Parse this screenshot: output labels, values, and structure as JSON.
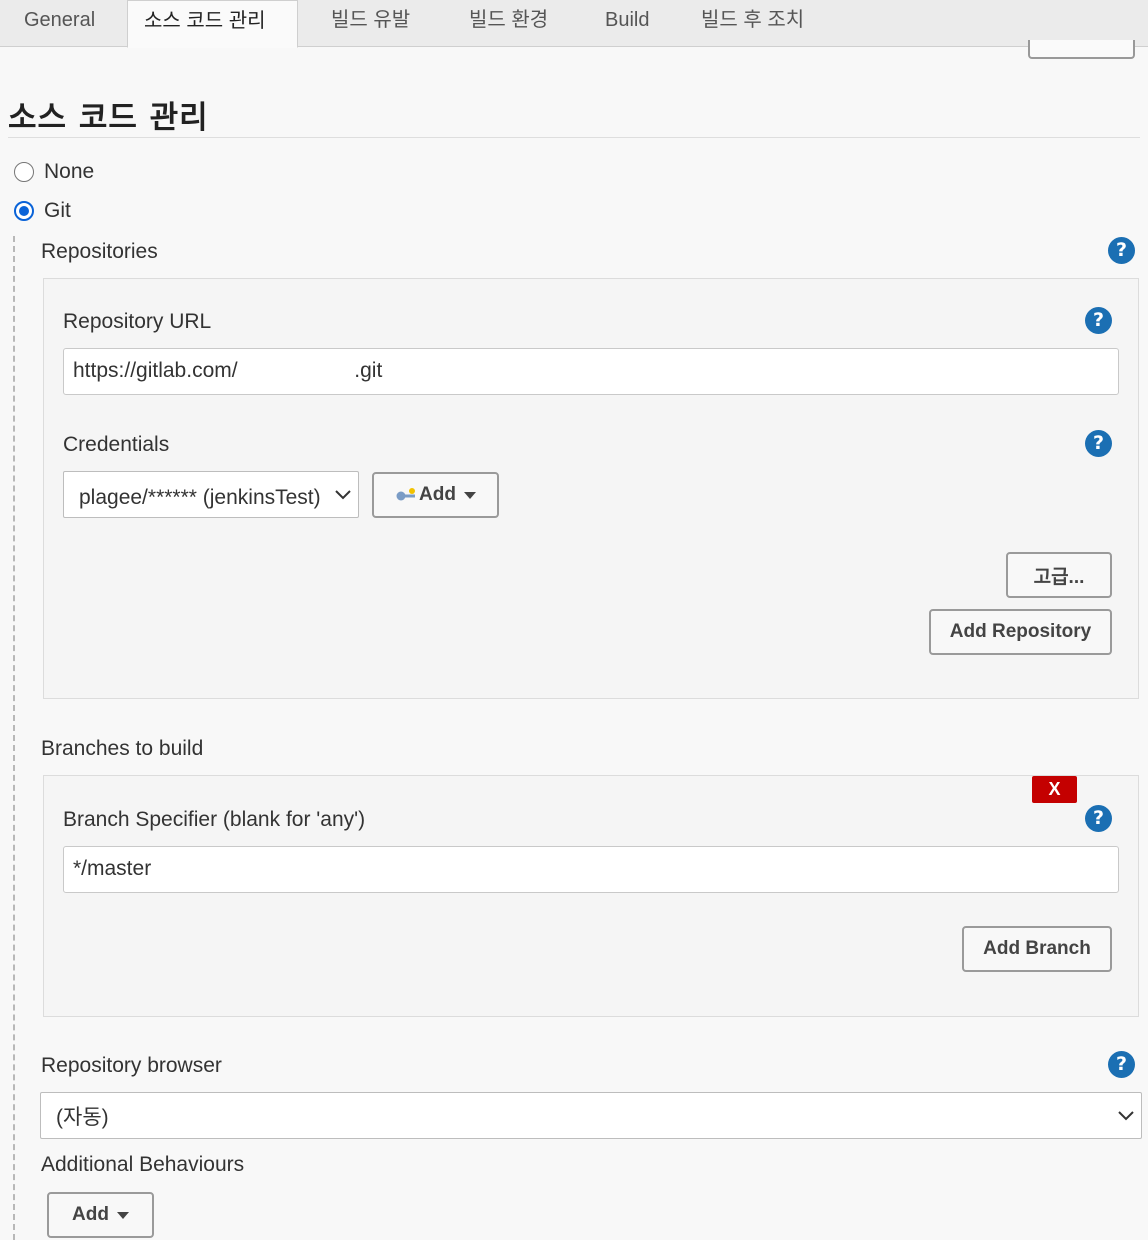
{
  "tabs": [
    {
      "label": "General",
      "active": false
    },
    {
      "label": "소스 코드 관리",
      "active": true
    },
    {
      "label": "빌드 유발",
      "active": false
    },
    {
      "label": "빌드 환경",
      "active": false
    },
    {
      "label": "Build",
      "active": false
    },
    {
      "label": "빌드 후 조치",
      "active": false
    }
  ],
  "scm": {
    "title": "소스 코드 관리",
    "options": {
      "none_label": "None",
      "git_label": "Git"
    },
    "selected": "Git"
  },
  "repositories": {
    "label": "Repositories",
    "url_label": "Repository URL",
    "url_value": "https://gitlab.com/                    .git",
    "credentials_label": "Credentials",
    "credentials_selected": "plagee/****** (jenkinsTest)",
    "add_label": "Add",
    "advanced_label": "고급...",
    "add_repository_label": "Add Repository"
  },
  "branches": {
    "label": "Branches to build",
    "delete_label": "X",
    "specifier_label": "Branch Specifier (blank for 'any')",
    "specifier_value": "*/master",
    "add_branch_label": "Add Branch"
  },
  "browser": {
    "label": "Repository browser",
    "selected": "(자동)"
  },
  "behaviours": {
    "label": "Additional Behaviours",
    "add_label": "Add"
  },
  "help_symbol": "?",
  "colors": {
    "accent": "#1b6fb3",
    "radio": "#0a63d8",
    "danger": "#c40000"
  }
}
